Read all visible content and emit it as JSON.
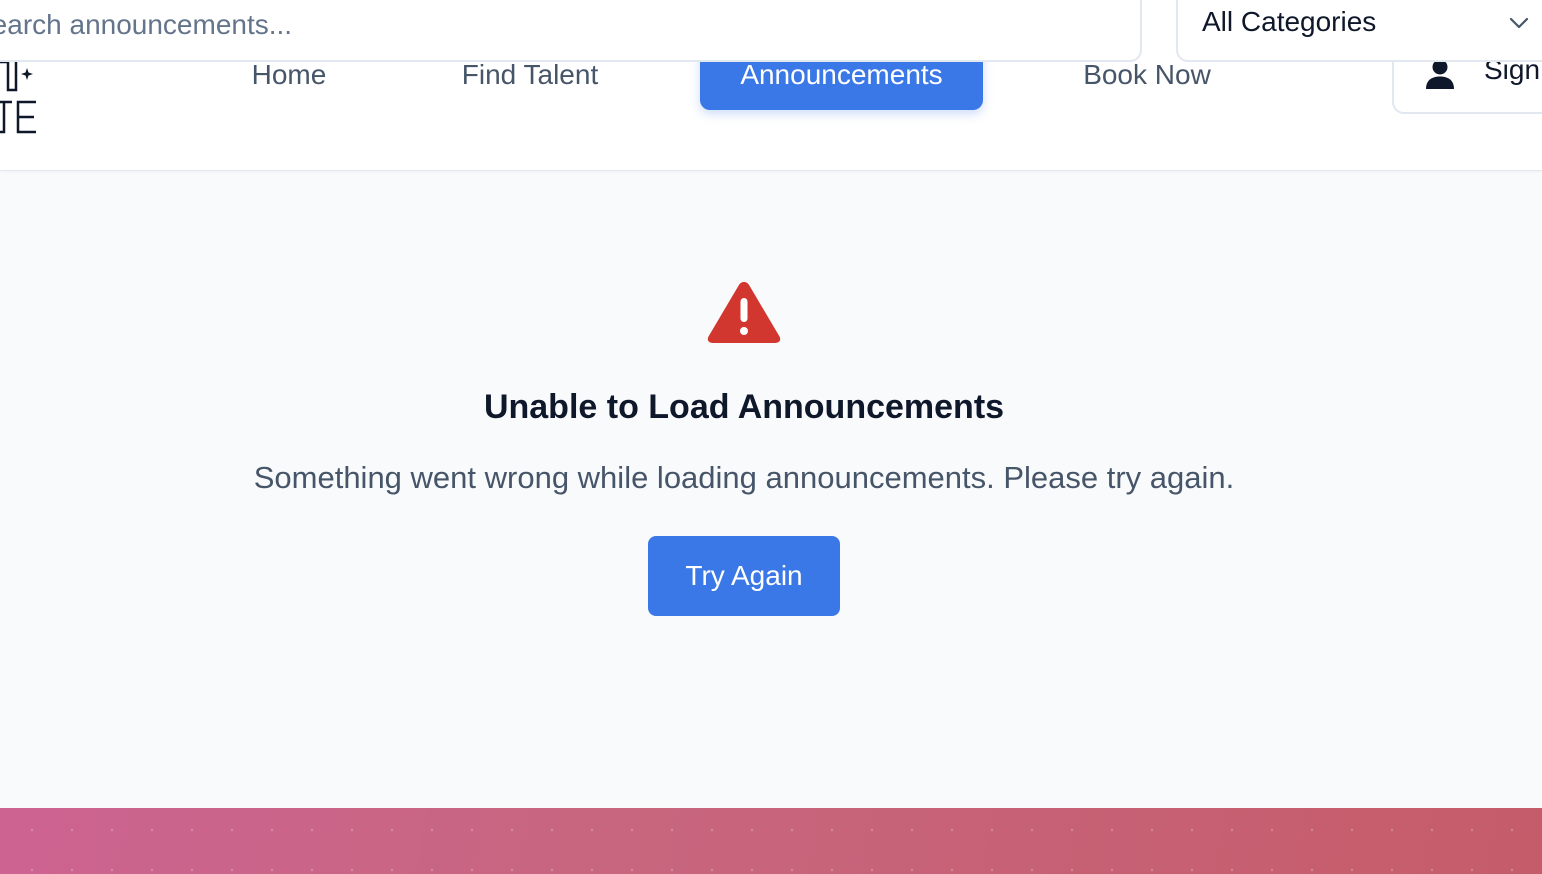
{
  "search": {
    "placeholder": "Search announcements..."
  },
  "category_filter": {
    "selected": "All Categories"
  },
  "nav": {
    "items": [
      {
        "label": "Home"
      },
      {
        "label": "Find Talent"
      },
      {
        "label": "Announcements",
        "active": true
      },
      {
        "label": "Book Now"
      }
    ]
  },
  "auth": {
    "sign_in_label": "Sign In"
  },
  "error": {
    "title": "Unable to Load Announcements",
    "message": "Something went wrong while loading announcements. Please try again.",
    "retry_label": "Try Again",
    "icon": "warning-triangle-icon"
  },
  "colors": {
    "accent": "#3b78e7",
    "danger": "#d2372f",
    "text_primary": "#0f172a",
    "text_secondary": "#475569",
    "background": "#f8fafc",
    "footer_gradient_start": "#cc6391",
    "footer_gradient_end": "#c55c6a"
  }
}
